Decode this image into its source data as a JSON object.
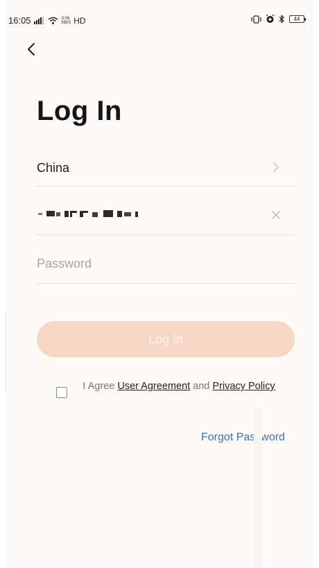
{
  "status_bar": {
    "time": "16:05",
    "speed_top": "0.06",
    "speed_bottom": "KB/S",
    "network": "HD",
    "battery": "44"
  },
  "page": {
    "title": "Log In"
  },
  "form": {
    "region_value": "China",
    "password_placeholder": "Password",
    "login_label": "Log In"
  },
  "agreement": {
    "prefix": "I Agree",
    "user_agreement": "User Agreement",
    "and": "and",
    "privacy_policy": "Privacy Policy"
  },
  "forgot_password": "Forgot Password",
  "colors": {
    "background": "#fdf9f7",
    "button_disabled": "#f6d7c5",
    "link": "#3b74a8"
  },
  "icons": {
    "back": "chevron-left-icon",
    "region": "chevron-right-icon",
    "clear": "close-icon"
  }
}
